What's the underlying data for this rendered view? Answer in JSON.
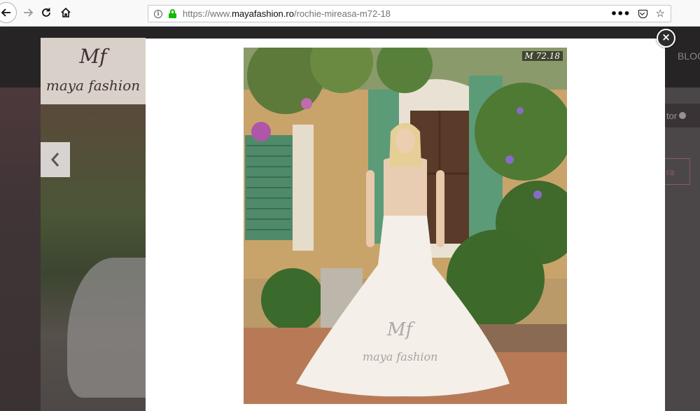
{
  "browser": {
    "url_prefix": "https://www.",
    "url_host": "mayafashion.ro",
    "url_path": "/rochie-mireasa-m72-18",
    "icons": [
      "back-arrow-icon",
      "forward-arrow-icon",
      "reload-icon",
      "home-icon",
      "info-icon",
      "lock-icon",
      "more-icon",
      "pocket-icon",
      "star-icon"
    ]
  },
  "site": {
    "logo_monogram": "Mf",
    "logo_text": "maya fashion",
    "nav_partial": "BLOG",
    "right_button_partial": "tor",
    "right_outline_partial": "ra"
  },
  "lightbox": {
    "model_code": "M 72.18",
    "watermark_monogram": "Mf",
    "watermark_text": "maya fashion",
    "close_symbol": "×"
  },
  "colors": {
    "lock_green": "#12bc00",
    "header_dark": "#262425",
    "accent_rose": "#8d5a63"
  }
}
